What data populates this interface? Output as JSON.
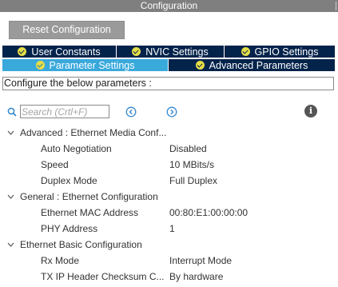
{
  "window": {
    "title": "Configuration"
  },
  "toolbar": {
    "reset_label": "Reset Configuration"
  },
  "tabs_row1": [
    {
      "label": "User Constants"
    },
    {
      "label": "NVIC Settings"
    },
    {
      "label": "GPIO Settings"
    }
  ],
  "tabs_row2": [
    {
      "label": "Parameter Settings",
      "active": true
    },
    {
      "label": "Advanced Parameters",
      "active": false
    }
  ],
  "hint": "Configure the below parameters :",
  "search": {
    "placeholder": "Search (Crtl+F)"
  },
  "icons": {
    "search": "search-icon",
    "prev": "arrow-left-circle-icon",
    "next": "arrow-right-circle-icon",
    "info": "info-icon",
    "info_glyph": "i",
    "check": "check-circle-icon",
    "expand": "chevron-down-icon"
  },
  "colors": {
    "tab_bg": "#03234b",
    "tab_active": "#39a9dc",
    "check": "#e5dd48",
    "titlebar": "#7f7f7f",
    "button": "#9a9a9a"
  },
  "groups": [
    {
      "label": "Advanced : Ethernet Media Conf...",
      "params": [
        {
          "name": "Auto Negotiation",
          "value": "Disabled"
        },
        {
          "name": "Speed",
          "value": "10 MBits/s"
        },
        {
          "name": "Duplex Mode",
          "value": "Full Duplex"
        }
      ]
    },
    {
      "label": "General : Ethernet Configuration",
      "params": [
        {
          "name": "Ethernet MAC Address",
          "value": "00:80:E1:00:00:00"
        },
        {
          "name": "PHY Address",
          "value": "1"
        }
      ]
    },
    {
      "label": "Ethernet Basic Configuration",
      "params": [
        {
          "name": "Rx Mode",
          "value": "Interrupt Mode"
        },
        {
          "name": "TX IP Header Checksum C...",
          "value": "By hardware"
        }
      ]
    }
  ]
}
